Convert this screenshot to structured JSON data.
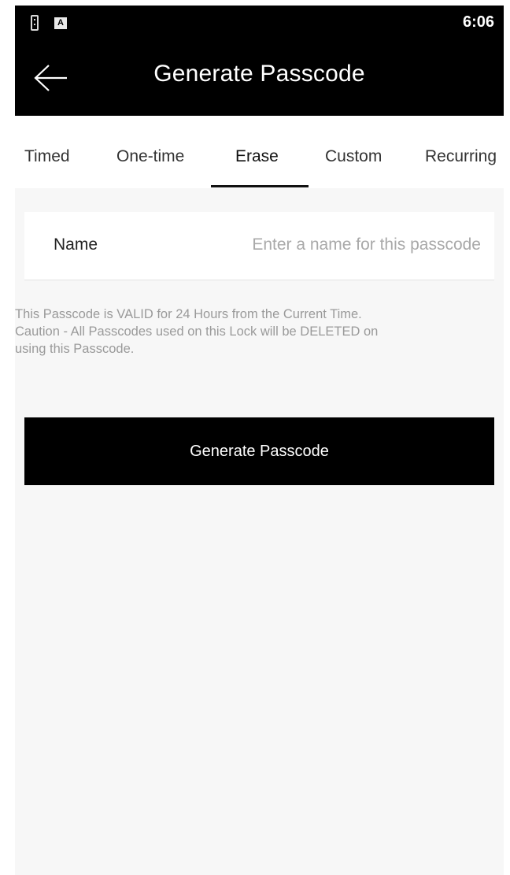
{
  "status_bar": {
    "time": "6:06",
    "icons": [
      "sim-card-icon",
      "a-notification-icon"
    ],
    "a_glyph": "A"
  },
  "app_bar": {
    "title": "Generate Passcode",
    "back_icon": "arrow-left-icon"
  },
  "tabs": [
    {
      "label": "Timed",
      "active": false
    },
    {
      "label": "One-time",
      "active": false
    },
    {
      "label": "Erase",
      "active": true
    },
    {
      "label": "Custom",
      "active": false
    },
    {
      "label": "Recurring",
      "active": false
    }
  ],
  "form": {
    "name_label": "Name",
    "name_value": "",
    "name_placeholder": "Enter a name for this passcode"
  },
  "info_lines": [
    "This Passcode is VALID for 24 Hours from the Current Time.",
    "Caution - All Passcodes used on this Lock will be DELETED on",
    "using this Passcode."
  ],
  "button": {
    "label": "Generate Passcode"
  },
  "colors": {
    "app_bar_bg": "#000000",
    "page_bg": "#f7f7f7",
    "button_bg": "#000000",
    "info_text": "#9a9a9a",
    "placeholder": "#a9a9a9"
  }
}
